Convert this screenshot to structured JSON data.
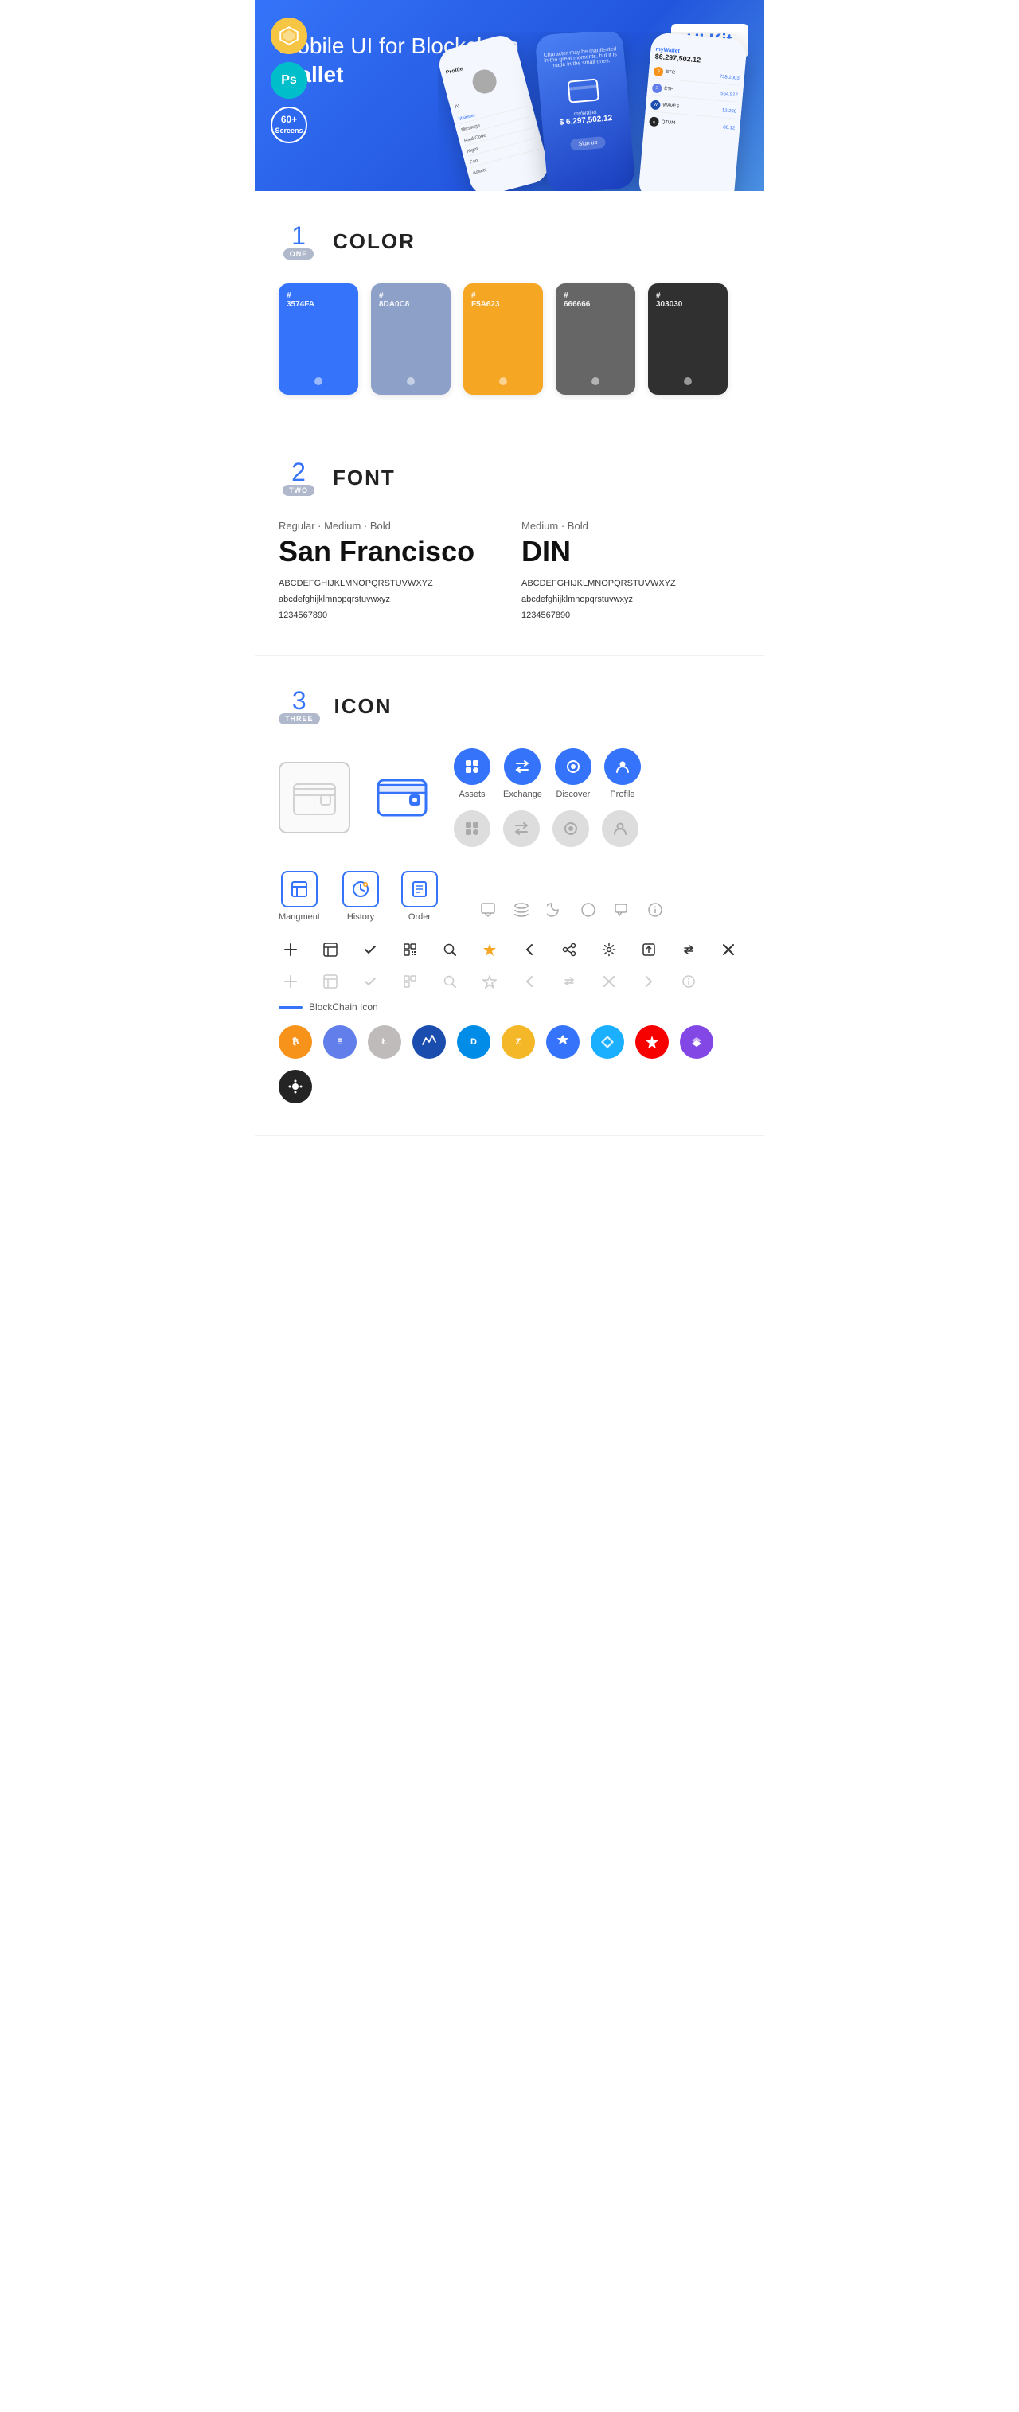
{
  "hero": {
    "title_normal": "Mobile UI for Blockchain ",
    "title_bold": "Wallet",
    "ui_kit_badge": "UI Kit",
    "badge_sketch_icon": "◇",
    "badge_ps_text": "Ps",
    "badge_screens_line1": "60+",
    "badge_screens_line2": "Screens"
  },
  "sections": {
    "color": {
      "number": "1",
      "number_label": "ONE",
      "title": "COLOR",
      "swatches": [
        {
          "hex": "#3574FA",
          "label": "3574FA"
        },
        {
          "hex": "#8DA0C8",
          "label": "8DA0C8"
        },
        {
          "hex": "#F5A623",
          "label": "F5A623"
        },
        {
          "hex": "#666666",
          "label": "666666"
        },
        {
          "hex": "#303030",
          "label": "303030"
        }
      ]
    },
    "font": {
      "number": "2",
      "number_label": "TWO",
      "title": "FONT",
      "font1": {
        "meta": "Regular · Medium · Bold",
        "name": "San Francisco",
        "uppercase": "ABCDEFGHIJKLMNOPQRSTUVWXYZ",
        "lowercase": "abcdefghijklmnopqrstuvwxyz",
        "numbers": "1234567890"
      },
      "font2": {
        "meta": "Medium · Bold",
        "name": "DIN",
        "uppercase": "ABCDEFGHIJKLMNOPQRSTUVWXYZ",
        "lowercase": "abcdefghijklmnopqrstuvwxyz",
        "numbers": "1234567890"
      }
    },
    "icon": {
      "number": "3",
      "number_label": "THREE",
      "title": "ICON",
      "nav_icons": [
        {
          "label": "Assets",
          "color_class": "colored"
        },
        {
          "label": "Exchange",
          "color_class": "colored"
        },
        {
          "label": "Discover",
          "color_class": "colored"
        },
        {
          "label": "Profile",
          "color_class": "colored"
        },
        {
          "label": "",
          "color_class": "gray"
        },
        {
          "label": "",
          "color_class": "gray"
        },
        {
          "label": "",
          "color_class": "gray"
        },
        {
          "label": "",
          "color_class": "gray"
        }
      ],
      "tab_icons": [
        {
          "label": "Mangment"
        },
        {
          "label": "History"
        },
        {
          "label": "Order"
        }
      ],
      "utility_icons": [
        "+",
        "⊞",
        "✓",
        "⊟",
        "⌕",
        "☆",
        "‹",
        "≮",
        "⚙",
        "⬛",
        "⇄",
        "✕"
      ],
      "utility_icons_muted": [
        "+",
        "⊞",
        "✓",
        "⊟",
        "⌕",
        "☆",
        "‹",
        "≮",
        "✕",
        "→",
        "ⓘ"
      ],
      "blockchain_label": "BlockChain Icon",
      "crypto_coins": [
        {
          "symbol": "₿",
          "class": "crypto-btc",
          "name": "Bitcoin"
        },
        {
          "symbol": "Ξ",
          "class": "crypto-eth",
          "name": "Ethereum"
        },
        {
          "symbol": "Ł",
          "class": "crypto-ltc",
          "name": "Litecoin"
        },
        {
          "symbol": "W",
          "class": "crypto-waves",
          "name": "Waves"
        },
        {
          "symbol": "D",
          "class": "crypto-dash",
          "name": "Dash"
        },
        {
          "symbol": "Z",
          "class": "crypto-zcash",
          "name": "Zcash"
        },
        {
          "symbol": "◈",
          "class": "crypto-grid",
          "name": "Grid"
        },
        {
          "symbol": "▲",
          "class": "crypto-stratis",
          "name": "Stratis"
        },
        {
          "symbol": "A",
          "class": "crypto-ark",
          "name": "Ark"
        },
        {
          "symbol": "◆",
          "class": "crypto-matic",
          "name": "Matic"
        },
        {
          "symbol": "●",
          "class": "crypto-iota",
          "name": "IOTA"
        }
      ]
    }
  }
}
